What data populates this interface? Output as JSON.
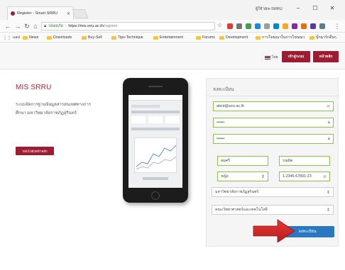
{
  "browser": {
    "tab_title": "Register - Smart SRRU",
    "profile_name": "ผู้ใช้ Win SRRU",
    "window_controls": {
      "minimize": "–",
      "maximize": "☐",
      "close": "✕"
    },
    "url_secure_label": "ปลอดภัย",
    "url_host": "https://mis.srru.ac.th",
    "url_path": "/register",
    "bookmarks": [
      {
        "label": "แอป",
        "icon": "apps-icon"
      },
      {
        "label": "News",
        "icon": "folder-icon"
      },
      {
        "label": "Downloads",
        "icon": "folder-icon"
      },
      {
        "label": "Buy-Sell",
        "icon": "folder-icon"
      },
      {
        "label": "Tips-Technique",
        "icon": "folder-icon"
      },
      {
        "label": "Entertainment",
        "icon": "folder-icon"
      },
      {
        "label": "Forums",
        "icon": "folder-icon"
      },
      {
        "label": "Development",
        "icon": "folder-icon"
      },
      {
        "label": "การโฆษณาในการโฆษณา",
        "icon": "folder-icon"
      },
      {
        "label": "บุ๊กมาร์กอื่นๆ",
        "icon": "folder-icon"
      }
    ]
  },
  "header": {
    "language_label": "ไทย",
    "register_button": "เข้าสู่ระบบ",
    "home_button": "หน้าหลัก"
  },
  "intro": {
    "brand": "MIS SRRU",
    "description_line1": "ระบบจัดการฐานข้อมูลสารสนเทศทางการ",
    "description_line2": "ศึกษา มหาวิทยาลัยราชภัฏสุรินทร์",
    "back_button": "กลับไปยังหน้าหลัก"
  },
  "form": {
    "title": "ลงทะเบียน",
    "email_value": "abcd@srru.ac.th",
    "password_value": "••••••",
    "confirm_password_value": "••••••",
    "first_name_value": "สมศรี",
    "last_name_value": "รณยิต",
    "gender_value": "หญิง",
    "id_card_value": "1-2345-67891-23",
    "university_value": "มหาวิทยาลัยราชภัฏสุรินทร์",
    "faculty_value": "คณะวิทยาศาสตร์และเทคโนโลยี",
    "submit_button": "ลงทะเบียน"
  },
  "colors": {
    "brand": "#9e1b32",
    "submit": "#2b78c2",
    "valid_border": "#8bc34a",
    "annotation_arrow": "#c62828"
  }
}
